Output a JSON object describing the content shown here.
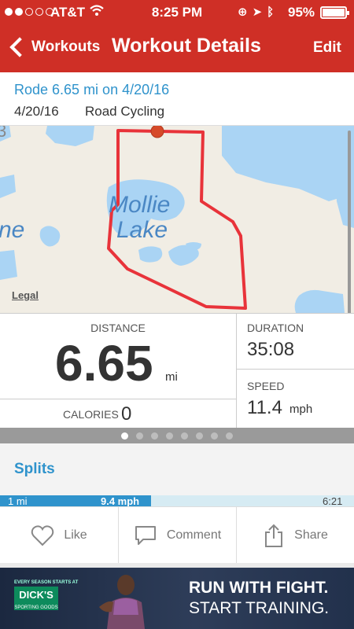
{
  "status_bar": {
    "carrier": "AT&T",
    "time": "8:25 PM",
    "battery": "95%"
  },
  "nav": {
    "back_label": "Workouts",
    "title": "Workout Details",
    "edit_label": "Edit"
  },
  "workout": {
    "title": "Rode 6.65 mi on 4/20/16",
    "date": "4/20/16",
    "activity": "Road Cycling"
  },
  "map": {
    "lake_label_line1": "Mollie",
    "lake_label_line2": "Lake",
    "partial_label_left": "ne",
    "partial_label_top": "3",
    "legal": "Legal",
    "route_color": "#e8333a",
    "water_color": "#aad4f4"
  },
  "stats": {
    "distance_label": "DISTANCE",
    "distance_value": "6.65",
    "distance_unit": "mi",
    "duration_label": "DURATION",
    "duration_value": "35:08",
    "speed_label": "SPEED",
    "speed_value": "11.4",
    "speed_unit": "mph",
    "calories_label": "CALORIES",
    "calories_value": "0"
  },
  "pager": {
    "pages": 8,
    "active": 0
  },
  "splits": {
    "title": "Splits",
    "rows": [
      {
        "mile": "1 mi",
        "speed": "9.4 mph",
        "time": "6:21"
      }
    ]
  },
  "actions": {
    "like": "Like",
    "comment": "Comment",
    "share": "Share"
  },
  "ad": {
    "tagline_small": "EVERY SEASON STARTS AT",
    "logo": "DICK'S",
    "logo_sub": "SPORTING GOODS",
    "headline1": "RUN WITH FIGHT.",
    "headline2": "START TRAINING."
  },
  "colors": {
    "header_red": "#cf2f26",
    "accent_blue": "#2f93cc"
  }
}
